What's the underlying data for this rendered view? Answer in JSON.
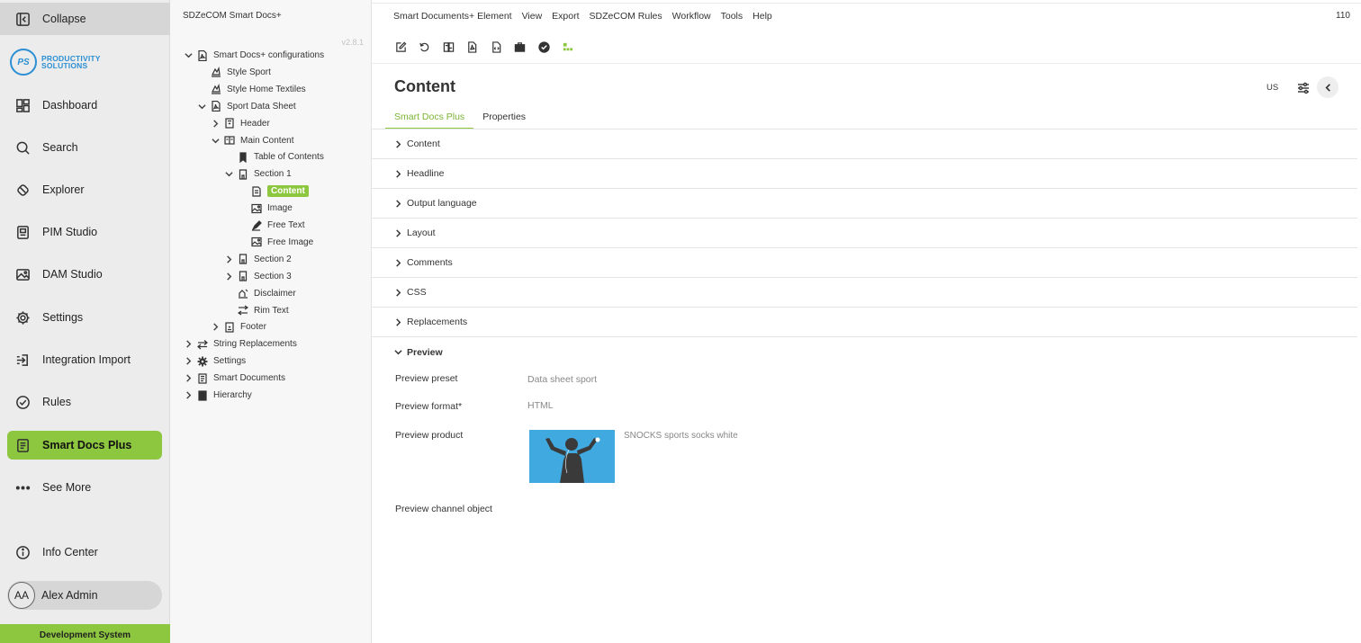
{
  "nav": {
    "collapse": "Collapse",
    "logo": {
      "mark": "PS",
      "line1": "PRODUCTIVITY",
      "line2": "SOLUTIONS"
    },
    "items": [
      {
        "label": "Dashboard",
        "icon": "dashboard-icon"
      },
      {
        "label": "Search",
        "icon": "search-icon"
      },
      {
        "label": "Explorer",
        "icon": "explorer-icon"
      },
      {
        "label": "PIM Studio",
        "icon": "pim-studio-icon"
      },
      {
        "label": "DAM Studio",
        "icon": "dam-studio-icon"
      },
      {
        "label": "Settings",
        "icon": "gear-icon"
      },
      {
        "label": "Integration Import",
        "icon": "import-icon"
      },
      {
        "label": "Rules",
        "icon": "check-circle-icon"
      },
      {
        "label": "Smart Docs Plus",
        "icon": "smart-docs-icon",
        "active": true
      },
      {
        "label": "See More",
        "icon": "more-dots-icon"
      }
    ],
    "info_center": "Info Center",
    "user": {
      "initials": "AA",
      "name": "Alex Admin"
    },
    "environment": "Development System",
    "accent_color": "#8dc63f"
  },
  "tree": {
    "header": "SDZeCOM Smart Docs+",
    "version": "v2.8.1",
    "nodes": [
      {
        "label": "Smart Docs+ configurations",
        "icon": "pdf-icon",
        "chevron": "down"
      },
      {
        "label": "Style Sport",
        "icon": "style-icon",
        "chevron": ""
      },
      {
        "label": "Style Home Textiles",
        "icon": "style-icon",
        "chevron": ""
      },
      {
        "label": "Sport Data Sheet",
        "icon": "pdf-icon",
        "chevron": "down"
      },
      {
        "label": "Header",
        "icon": "header-icon",
        "chevron": "right"
      },
      {
        "label": "Main Content",
        "icon": "main-content-icon",
        "chevron": "down"
      },
      {
        "label": "Table of Contents",
        "icon": "bookmark-icon",
        "chevron": ""
      },
      {
        "label": "Section 1",
        "icon": "section-icon",
        "chevron": "down"
      },
      {
        "label": "Content",
        "icon": "content-icon",
        "chevron": "",
        "selected": true
      },
      {
        "label": "Image",
        "icon": "image-icon",
        "chevron": ""
      },
      {
        "label": "Free Text",
        "icon": "free-text-icon",
        "chevron": ""
      },
      {
        "label": "Free Image",
        "icon": "image-icon",
        "chevron": ""
      },
      {
        "label": "Section 2",
        "icon": "section-icon",
        "chevron": "right"
      },
      {
        "label": "Section 3",
        "icon": "section-icon",
        "chevron": "right"
      },
      {
        "label": "Disclaimer",
        "icon": "disclaimer-icon",
        "chevron": ""
      },
      {
        "label": "Rim Text",
        "icon": "rim-text-icon",
        "chevron": ""
      },
      {
        "label": "Footer",
        "icon": "footer-icon",
        "chevron": "right"
      },
      {
        "label": "String Replacements",
        "icon": "swap-icon",
        "chevron": "right"
      },
      {
        "label": "Settings",
        "icon": "gear-icon",
        "chevron": "right"
      },
      {
        "label": "Smart Documents",
        "icon": "documents-icon",
        "chevron": "right"
      },
      {
        "label": "Hierarchy",
        "icon": "hierarchy-icon",
        "chevron": "right"
      }
    ]
  },
  "main": {
    "menu": [
      "Smart Documents+ Element",
      "View",
      "Export",
      "SDZeCOM Rules",
      "Workflow",
      "Tools",
      "Help"
    ],
    "counter": "110",
    "toolbar_icons": [
      "edit-icon",
      "refresh-icon",
      "compare-icon",
      "pdf-export-icon",
      "code-icon",
      "briefcase-icon",
      "check-badge-icon",
      "tree-structure-icon"
    ],
    "title": "Content",
    "locale": "US",
    "tabs": [
      {
        "label": "Smart Docs Plus",
        "active": true
      },
      {
        "label": "Properties",
        "active": false
      }
    ],
    "sections": [
      "Content",
      "Headline",
      "Output language",
      "Layout",
      "Comments",
      "CSS",
      "Replacements"
    ],
    "preview": {
      "title": "Preview",
      "preset_label": "Preview preset",
      "preset_value": "Data sheet sport",
      "format_label": "Preview format*",
      "format_value": "HTML",
      "product_label": "Preview product",
      "product_name": "SNOCKS sports socks white",
      "channel_label": "Preview channel object"
    }
  }
}
